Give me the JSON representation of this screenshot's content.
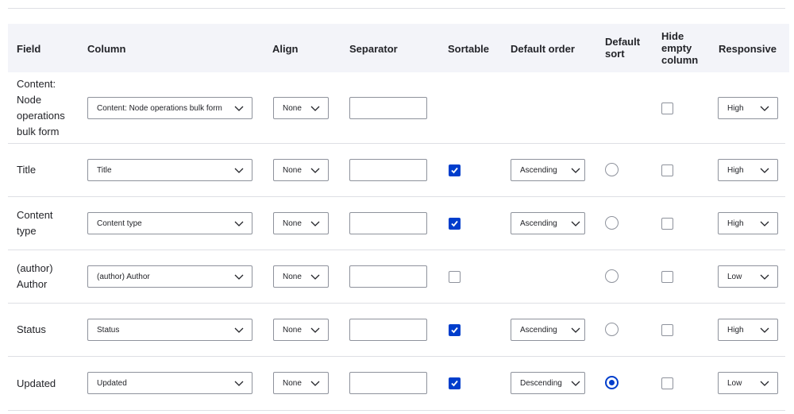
{
  "headers": {
    "field": "Field",
    "column": "Column",
    "align": "Align",
    "separator": "Separator",
    "sortable": "Sortable",
    "default_order": "Default order",
    "default_sort_1": "Default",
    "default_sort_2": "sort",
    "hide_empty_1": "Hide",
    "hide_empty_2": "empty",
    "hide_empty_3": "column",
    "responsive": "Responsive"
  },
  "rows": [
    {
      "field_lines": [
        "Content:",
        "Node",
        "operations",
        "bulk form"
      ],
      "column": "Content: Node operations bulk form",
      "align": "None",
      "separator": "",
      "sortable": null,
      "default_order": null,
      "default_sort": null,
      "hide_empty": false,
      "responsive": "High"
    },
    {
      "field_lines": [
        "Title"
      ],
      "column": "Title",
      "align": "None",
      "separator": "",
      "sortable": true,
      "default_order": "Ascending",
      "default_sort": false,
      "hide_empty": false,
      "responsive": "High"
    },
    {
      "field_lines": [
        "Content",
        "type"
      ],
      "column": "Content type",
      "align": "None",
      "separator": "",
      "sortable": true,
      "default_order": "Ascending",
      "default_sort": false,
      "hide_empty": false,
      "responsive": "High"
    },
    {
      "field_lines": [
        "(author)",
        "Author"
      ],
      "column": "(author) Author",
      "align": "None",
      "separator": "",
      "sortable": false,
      "default_order": null,
      "default_sort": false,
      "hide_empty": false,
      "responsive": "Low"
    },
    {
      "field_lines": [
        "Status"
      ],
      "column": "Status",
      "align": "None",
      "separator": "",
      "sortable": true,
      "default_order": "Ascending",
      "default_sort": false,
      "hide_empty": false,
      "responsive": "High"
    },
    {
      "field_lines": [
        "Updated"
      ],
      "column": "Updated",
      "align": "None",
      "separator": "",
      "sortable": true,
      "default_order": "Descending",
      "default_sort": true,
      "hide_empty": false,
      "responsive": "Low"
    }
  ],
  "icons": {
    "dropdown": "chevron-down-icon",
    "checked": "checkmark-icon"
  },
  "colors": {
    "accent": "#003ecc",
    "header_bg": "#f3f4f9",
    "border": "#8e929c",
    "divider": "#dedfe4",
    "text": "#232429"
  }
}
